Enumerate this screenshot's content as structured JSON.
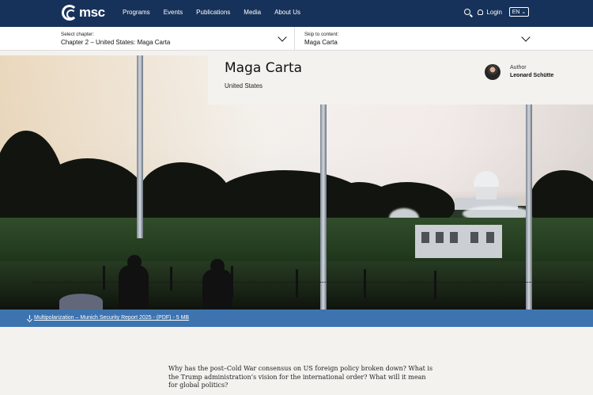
{
  "header": {
    "logo_text": "msc",
    "nav": [
      "Programs",
      "Events",
      "Publications",
      "Media",
      "About Us"
    ],
    "login_label": "Login",
    "language": "EN",
    "icons": [
      "search-icon",
      "user-icon",
      "chevron-down-icon"
    ]
  },
  "chapter_selector": {
    "label": "Select chapter:",
    "value": "Chapter 2 – United States: Maga Carta"
  },
  "skip_selector": {
    "label": "Skip to content:",
    "value": "Maga Carta"
  },
  "article": {
    "title": "Maga Carta",
    "country": "United States",
    "author_label": "Author",
    "author_name": "Leonard Schütte"
  },
  "download": {
    "label": "Multipolarization – Munich Security Report 2025 - (PDF) - 5 MB"
  },
  "intro": {
    "text": "Why has the post–Cold War consensus on US foreign policy broken down? What is the Trump administration’s vision for the international order? What will it mean for global politics?"
  },
  "colors": {
    "header": "#17325a",
    "download_bar": "#3d74b0",
    "page_background": "#f4f2ee"
  }
}
